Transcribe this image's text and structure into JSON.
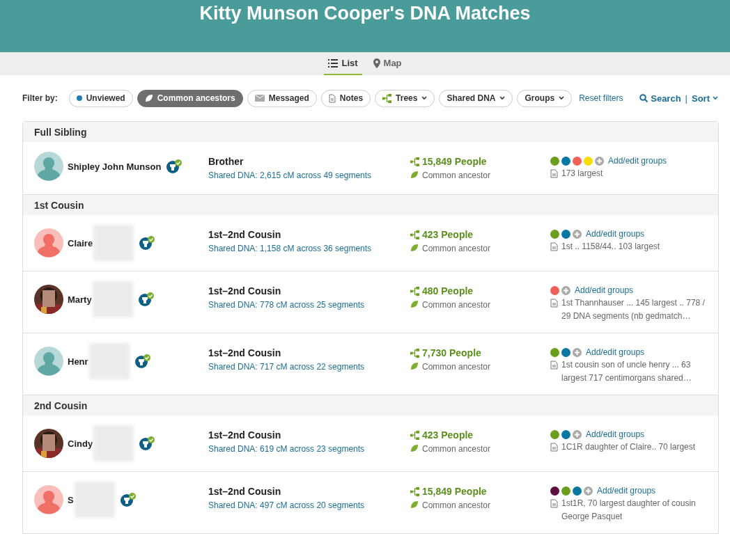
{
  "header": {
    "title": "Kitty Munson Cooper's DNA Matches"
  },
  "view_tabs": [
    {
      "label": "List",
      "kind": "list",
      "selected": true
    },
    {
      "label": "Map",
      "kind": "map",
      "selected": false
    }
  ],
  "filter_bar": {
    "label": "Filter by:",
    "filters": [
      {
        "label": "Unviewed",
        "kind": "dot",
        "selected": false
      },
      {
        "label": "Common ancestors",
        "kind": "leaf",
        "selected": true
      },
      {
        "label": "Messaged",
        "kind": "mail",
        "selected": false
      },
      {
        "label": "Notes",
        "kind": "note",
        "selected": false
      },
      {
        "label": "Trees",
        "kind": "tree",
        "selected": false
      },
      {
        "label": "Shared DNA",
        "kind": "dropdown",
        "selected": false
      },
      {
        "label": "Groups",
        "kind": "dropdown",
        "selected": false
      }
    ],
    "reset": "Reset filters",
    "search": "Search",
    "separator": "|",
    "sort": "Sort"
  },
  "sections": [
    {
      "title": "Full Sibling",
      "matches": [
        {
          "name": "Shipley John Munson",
          "redacted": false,
          "avatar": {
            "kind": "silhouette",
            "color": "#5fa8a6"
          },
          "relation": "Brother",
          "shared_dna": "Shared DNA: 2,615 cM across 49 segments",
          "people": "15,849 People",
          "ancestor": "Common ancestor",
          "groups": [
            {
              "color": "#6a9f1c"
            },
            {
              "color": "#0a77a3"
            },
            {
              "color": "#ef6158"
            },
            {
              "color": "#f9dc00"
            }
          ],
          "groups_link": "Add/edit groups",
          "note": "173 largest"
        }
      ]
    },
    {
      "title": "1st Cousin",
      "matches": [
        {
          "name": "Claire",
          "redacted": true,
          "avatar": {
            "kind": "silhouette",
            "color": "#f07067"
          },
          "relation": "1st–2nd Cousin",
          "shared_dna": "Shared DNA: 1,158 cM across 36 segments",
          "people": "423 People",
          "ancestor": "Common ancestor",
          "groups": [
            {
              "color": "#6a9f1c"
            },
            {
              "color": "#0a77a3"
            }
          ],
          "groups_link": "Add/edit groups",
          "note": "1st .. 1158/44.. 103 largest"
        },
        {
          "name": "Marty",
          "redacted": true,
          "avatar": {
            "kind": "picture"
          },
          "relation": "1st–2nd Cousin",
          "shared_dna": "Shared DNA: 778 cM across 25 segments",
          "people": "480 People",
          "ancestor": "Common ancestor",
          "groups": [
            {
              "color": "#ef6158"
            }
          ],
          "groups_link": "Add/edit groups",
          "note": "1st Thannhauser ... 145 largest .. 778 / 29 DNA segments (nb gedmatch…"
        },
        {
          "name": "Henr",
          "redacted": true,
          "avatar": {
            "kind": "silhouette",
            "color": "#5fa8a6"
          },
          "relation": "1st–2nd Cousin",
          "shared_dna": "Shared DNA: 717 cM across 22 segments",
          "people": "7,730 People",
          "ancestor": "Common ancestor",
          "groups": [
            {
              "color": "#6a9f1c"
            },
            {
              "color": "#0a77a3"
            }
          ],
          "groups_link": "Add/edit groups",
          "note": "1st cousin son of uncle henry ... 63 largest 717 centimorgans shared…"
        }
      ]
    },
    {
      "title": "2nd Cousin",
      "matches": [
        {
          "name": "Cindy",
          "redacted": true,
          "avatar": {
            "kind": "picture"
          },
          "relation": "1st–2nd Cousin",
          "shared_dna": "Shared DNA: 619 cM across 23 segments",
          "people": "423 People",
          "ancestor": "Common ancestor",
          "groups": [
            {
              "color": "#6a9f1c"
            },
            {
              "color": "#0a77a3"
            }
          ],
          "groups_link": "Add/edit groups",
          "note": "1C1R daughter of Claire.. 70 largest"
        },
        {
          "name": "S",
          "redacted": true,
          "avatar": {
            "kind": "silhouette",
            "color": "#f07067"
          },
          "relation": "1st–2nd Cousin",
          "shared_dna": "Shared DNA: 497 cM across 20 segments",
          "people": "15,849 People",
          "ancestor": "Common ancestor",
          "groups": [
            {
              "color": "#5c0f3e"
            },
            {
              "color": "#6a9f1c"
            },
            {
              "color": "#0a77a3"
            }
          ],
          "groups_link": "Add/edit groups",
          "note": "1st1R, 70 largest daughter of cousin George Pasquet"
        }
      ]
    }
  ]
}
